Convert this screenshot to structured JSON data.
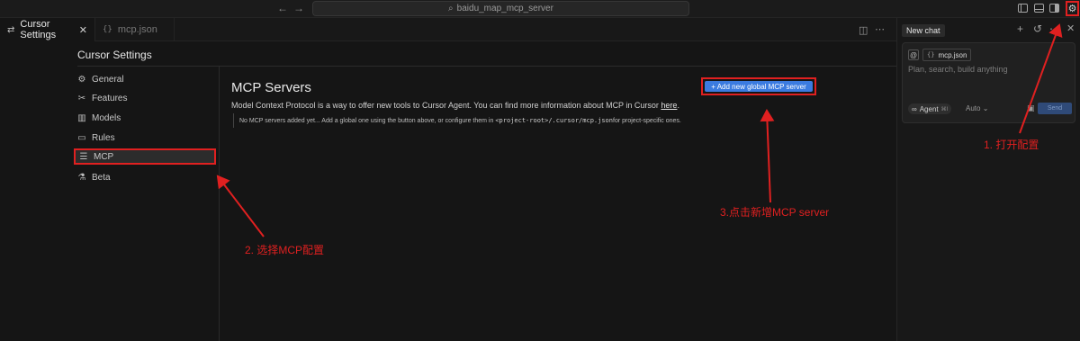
{
  "titlebar": {
    "search_text": "baidu_map_mcp_server",
    "back_icon": "arrow-left-icon",
    "forward_icon": "arrow-right-icon"
  },
  "tabs": [
    {
      "label": "Cursor Settings",
      "icon": "settings-sliders-icon",
      "active": true
    },
    {
      "label": "mcp.json",
      "icon": "json-braces-icon",
      "active": false
    }
  ],
  "settings": {
    "title": "Cursor Settings",
    "sidebar": [
      {
        "label": "General",
        "icon": "gear-icon"
      },
      {
        "label": "Features",
        "icon": "tools-icon"
      },
      {
        "label": "Models",
        "icon": "models-icon"
      },
      {
        "label": "Rules",
        "icon": "rules-icon"
      },
      {
        "label": "MCP",
        "icon": "server-icon",
        "selected": true
      },
      {
        "label": "Beta",
        "icon": "flask-icon"
      }
    ]
  },
  "mcp": {
    "title": "MCP Servers",
    "desc_before": "Model Context Protocol is a way to offer new tools to Cursor Agent. You can find more information about MCP in Cursor ",
    "desc_link": "here",
    "desc_after": ".",
    "note_before": "No MCP servers added yet... Add a global one using the button above, or configure them in ",
    "note_code": "<project-root>/.cursor/mcp.json",
    "note_after": " for project-specific ones.",
    "add_button": "+ Add new global MCP server"
  },
  "chat": {
    "tab_label": "New chat",
    "file_chip": "mcp.json",
    "placeholder": "Plan, search, build anything",
    "agent_label": "Agent",
    "agent_shortcut": "⌘I",
    "model_label": "Auto",
    "send_label": "Send"
  },
  "annotations": {
    "step1": "1. 打开配置",
    "step2": "2. 选择MCP配置",
    "step3": "3.点击新增MCP server"
  },
  "colors": {
    "accent_blue": "#3b7be0",
    "annotation_red": "#e02020",
    "background": "#151515"
  }
}
